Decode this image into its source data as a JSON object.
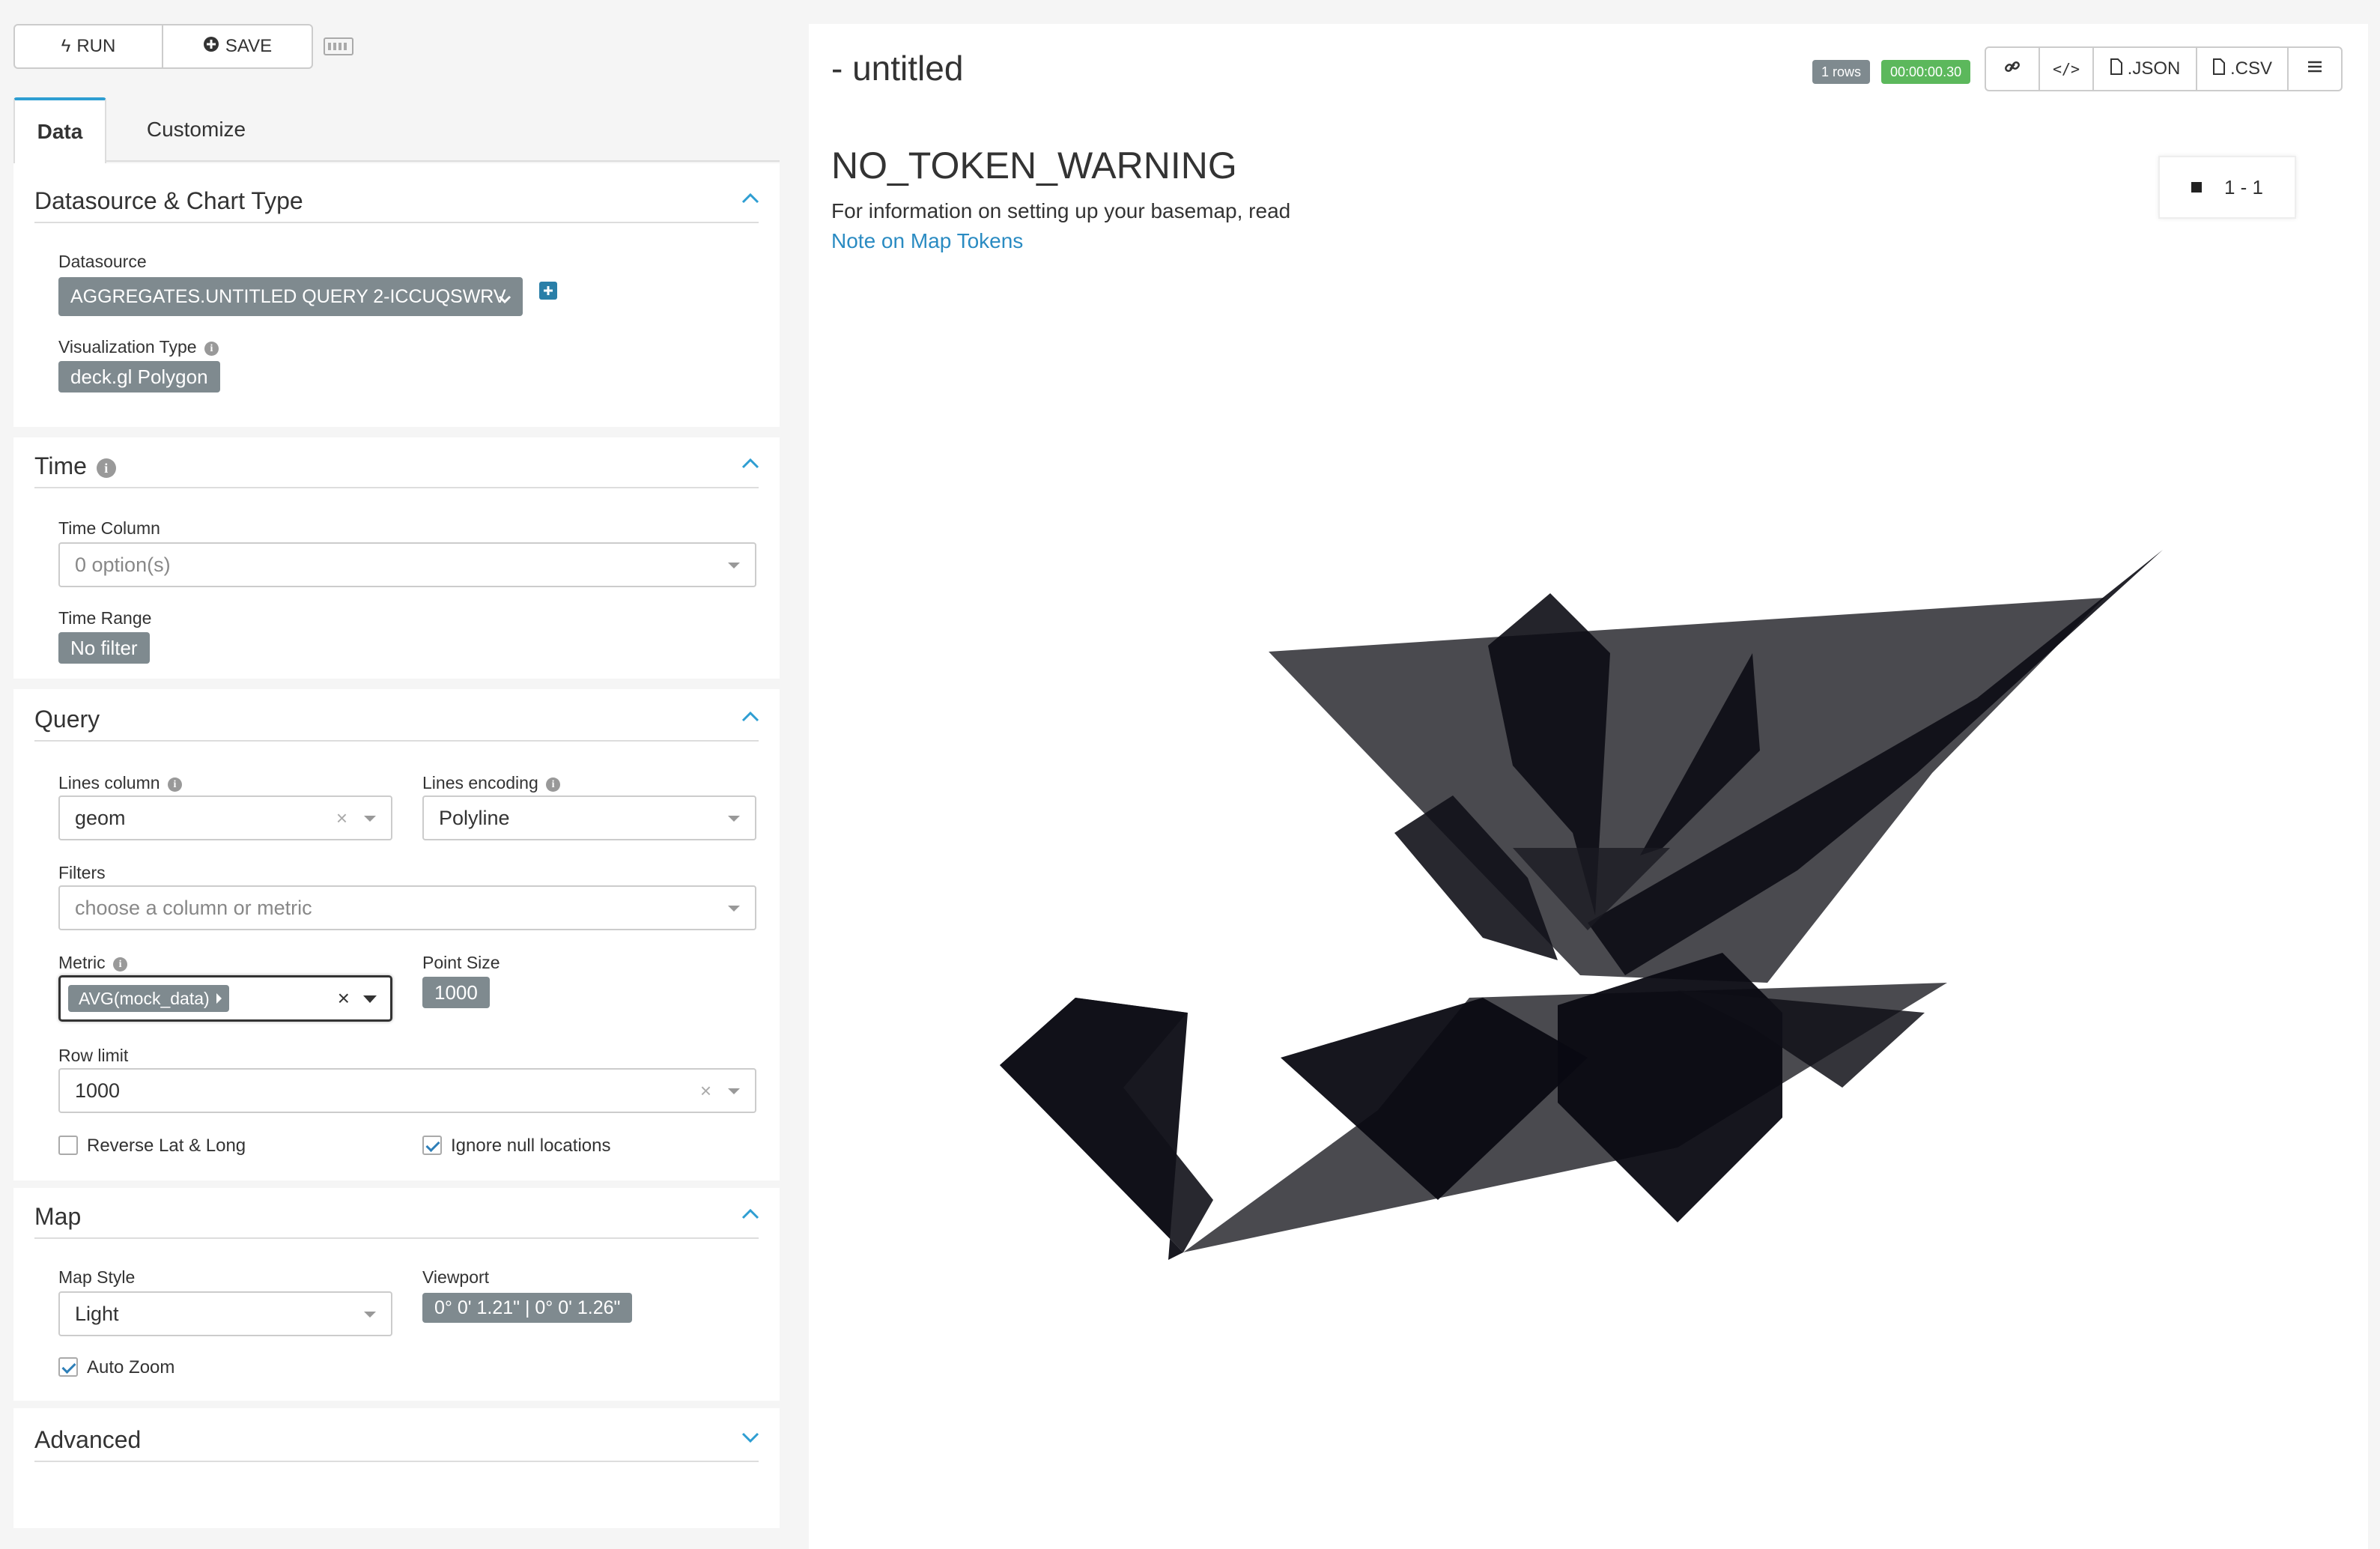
{
  "toolbar": {
    "run_label": "RUN",
    "save_label": "SAVE"
  },
  "tabs": [
    {
      "label": "Data"
    },
    {
      "label": "Customize"
    }
  ],
  "sections": {
    "datasource": {
      "title": "Datasource & Chart Type",
      "datasource_label": "Datasource",
      "datasource_value": "AGGREGATES.UNTITLED QUERY 2-ICCUQSWRV",
      "viz_type_label": "Visualization Type",
      "viz_type_value": "deck.gl Polygon"
    },
    "time": {
      "title": "Time",
      "time_column_label": "Time Column",
      "time_column_placeholder": "0 option(s)",
      "time_range_label": "Time Range",
      "time_range_value": "No filter"
    },
    "query": {
      "title": "Query",
      "lines_column_label": "Lines column",
      "lines_column_value": "geom",
      "lines_encoding_label": "Lines encoding",
      "lines_encoding_value": "Polyline",
      "filters_label": "Filters",
      "filters_placeholder": "choose a column or metric",
      "metric_label": "Metric",
      "metric_value": "AVG(mock_data)",
      "point_size_label": "Point Size",
      "point_size_value": "1000",
      "row_limit_label": "Row limit",
      "row_limit_value": "1000",
      "reverse_label": "Reverse Lat & Long",
      "reverse_checked": false,
      "ignore_null_label": "Ignore null locations",
      "ignore_null_checked": true
    },
    "map": {
      "title": "Map",
      "map_style_label": "Map Style",
      "map_style_value": "Light",
      "viewport_label": "Viewport",
      "viewport_value": "0° 0' 1.21\" | 0° 0' 1.26\"",
      "auto_zoom_label": "Auto Zoom",
      "auto_zoom_checked": true
    },
    "advanced": {
      "title": "Advanced"
    }
  },
  "chart": {
    "title": "- untitled",
    "rows_badge": "1 rows",
    "time_badge": "00:00:00.30",
    "json_label": ".JSON",
    "csv_label": ".CSV",
    "warning_title": "NO_TOKEN_WARNING",
    "warning_text": "For information on setting up your basemap, read",
    "warning_link": "Note on Map Tokens",
    "legend_label": "1 - 1"
  },
  "colors": {
    "accent": "#2e9ed2",
    "badge_gray": "#7f8a8f",
    "success_green": "#5cb85c",
    "link": "#2a8bc2",
    "polygon_fill": "#1e1e28"
  }
}
